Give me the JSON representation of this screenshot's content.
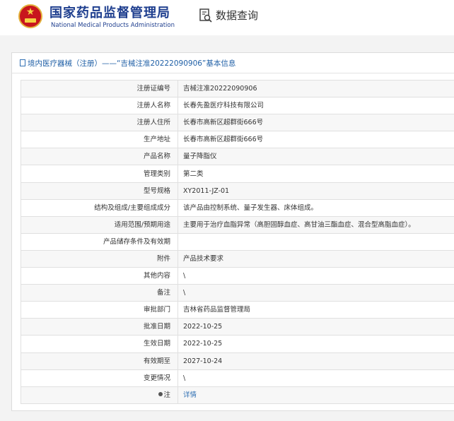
{
  "header": {
    "org_cn": "国家药品监督管理局",
    "org_en": "National Medical Products Administration",
    "query_title": "数据查询",
    "brand_color": "#1f3f8f",
    "emblem_color": "#c8161d"
  },
  "panel": {
    "title": "境内医疗器械（注册）——“吉械注准20222090906”基本信息"
  },
  "rows": [
    {
      "label": "注册证编号",
      "value": "吉械注准20222090906"
    },
    {
      "label": "注册人名称",
      "value": "长春先盈医疗科技有限公司"
    },
    {
      "label": "注册人住所",
      "value": "长春市高新区超群街666号"
    },
    {
      "label": "生产地址",
      "value": "长春市高新区超群街666号"
    },
    {
      "label": "产品名称",
      "value": "量子降脂仪"
    },
    {
      "label": "管理类别",
      "value": "第二类"
    },
    {
      "label": "型号规格",
      "value": "XY2011-JZ-01"
    },
    {
      "label": "结构及组成/主要组成成分",
      "value": "该产品由控制系统、量子发生器、床体组成。"
    },
    {
      "label": "适用范围/预期用途",
      "value": "主要用于治疗血脂异常（高胆固醇血症、高甘油三酯血症、混合型高脂血症）。"
    },
    {
      "label": "产品储存条件及有效期",
      "value": ""
    },
    {
      "label": "附件",
      "value": "产品技术要求"
    },
    {
      "label": "其他内容",
      "value": "\\"
    },
    {
      "label": "备注",
      "value": "\\"
    },
    {
      "label": "审批部门",
      "value": "吉林省药品监督管理局"
    },
    {
      "label": "批准日期",
      "value": "2022-10-25"
    },
    {
      "label": "生效日期",
      "value": "2022-10-25"
    },
    {
      "label": "有效期至",
      "value": "2027-10-24"
    },
    {
      "label": "变更情况",
      "value": "\\"
    }
  ],
  "note_row": {
    "label": "注",
    "link_text": "详情",
    "link_color": "#2f6fb3"
  }
}
